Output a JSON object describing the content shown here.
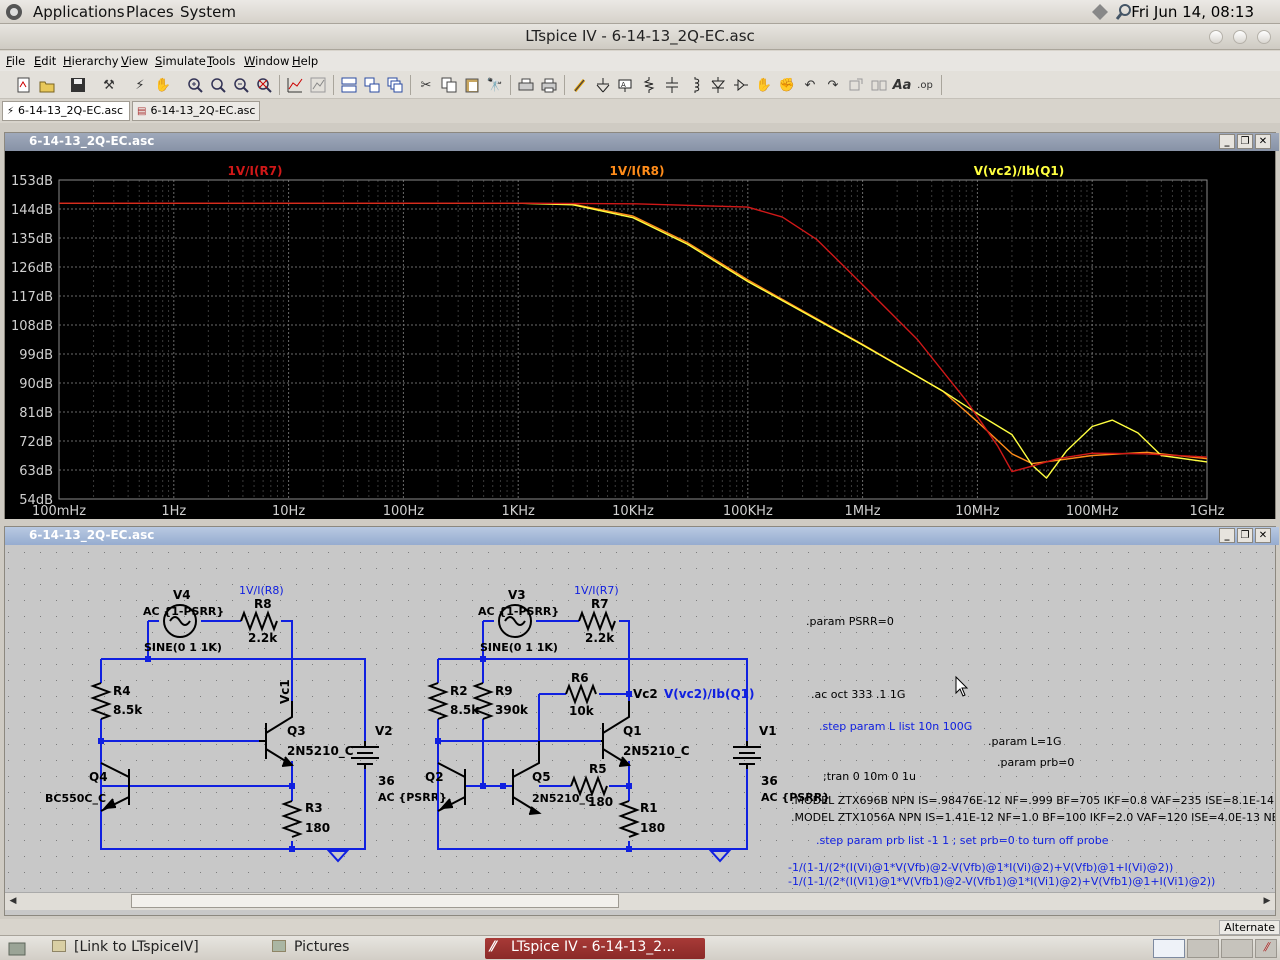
{
  "top_panel": {
    "menus": [
      "Applications",
      "Places",
      "System"
    ],
    "clock": "Fri Jun 14, 08:13"
  },
  "window": {
    "title": "LTspice IV - 6-14-13_2Q-EC.asc"
  },
  "menubar": [
    "File",
    "Edit",
    "Hierarchy",
    "View",
    "Simulate",
    "Tools",
    "Window",
    "Help"
  ],
  "toolbar_icons": [
    "new-schematic-icon",
    "open-icon",
    "save-icon",
    "control-panel-icon",
    "run-icon",
    "halt-icon",
    "zoom-in-icon",
    "zoom-out-icon",
    "zoom-fit-icon",
    "zoom-cancel-icon",
    "autorange-icon",
    "pick-trace-icon",
    "tile-horizontal-icon",
    "tile-vertical-icon",
    "cascade-icon",
    "cut-icon",
    "copy-icon",
    "paste-icon",
    "find-icon",
    "print-setup-icon",
    "print-icon",
    "draw-wire-icon",
    "ground-icon",
    "label-net-icon",
    "resistor-icon",
    "capacitor-icon",
    "inductor-icon",
    "diode-icon",
    "component-icon",
    "move-icon",
    "drag-icon",
    "undo-icon",
    "redo-icon",
    "rotate-icon",
    "mirror-icon",
    "text-icon",
    "spice-directive-icon"
  ],
  "doc_tabs": [
    {
      "label": "6-14-13_2Q-EC.asc",
      "icon": "schematic-tab-icon"
    },
    {
      "label": "6-14-13_2Q-EC.asc",
      "icon": "waveform-tab-icon"
    }
  ],
  "plot_window": {
    "title": "6-14-13_2Q-EC.asc"
  },
  "chart_data": {
    "type": "line",
    "x_scale": "log",
    "xlim": [
      0.1,
      1000000000
    ],
    "ylim": [
      54,
      153
    ],
    "grid": true,
    "x_tick_labels": [
      "100mHz",
      "1Hz",
      "10Hz",
      "100Hz",
      "1KHz",
      "10KHz",
      "100KHz",
      "1MHz",
      "10MHz",
      "100MHz",
      "1GHz"
    ],
    "y_tick_labels": [
      "153dB",
      "144dB",
      "135dB",
      "126dB",
      "117dB",
      "108dB",
      "99dB",
      "90dB",
      "81dB",
      "72dB",
      "63dB",
      "54dB"
    ],
    "y_ticks": [
      153,
      144,
      135,
      126,
      117,
      108,
      99,
      90,
      81,
      72,
      63,
      54
    ],
    "series": [
      {
        "name": "1V/I(R7)",
        "color": "#d01818",
        "x": [
          0.1,
          1000,
          10000,
          100000,
          200000,
          400000,
          1000000,
          3000000,
          8000000,
          15000000,
          20000000,
          30000000,
          50000000,
          100000000,
          300000000,
          1000000000
        ],
        "y": [
          145.8,
          145.8,
          145.6,
          144.6,
          141.5,
          134.5,
          120.5,
          103.5,
          84.5,
          70.5,
          62.5,
          64.2,
          66.5,
          68.2,
          68.0,
          67.0
        ]
      },
      {
        "name": "1V/I(R8)",
        "color": "#ff8c1a",
        "x": [
          0.1,
          1000,
          3000,
          10000,
          30000,
          100000,
          1000000,
          5000000,
          10000000,
          20000000,
          30000000,
          50000000,
          100000000,
          300000000,
          1000000000
        ],
        "y": [
          145.8,
          145.8,
          145.5,
          141.8,
          133.5,
          122.0,
          102.0,
          87.5,
          78.0,
          68.0,
          65.0,
          66.0,
          67.5,
          68.5,
          66.5
        ]
      },
      {
        "name": "V(vc2)/Ib(Q1)",
        "color": "#ffff40",
        "x": [
          0.1,
          1000,
          3000,
          10000,
          30000,
          100000,
          1000000,
          5000000,
          10000000,
          20000000,
          30000000,
          40000000,
          60000000,
          100000000,
          150000000,
          250000000,
          400000000,
          1000000000
        ],
        "y": [
          145.8,
          145.8,
          145.3,
          141.3,
          133.0,
          121.5,
          101.8,
          87.5,
          80.5,
          74.0,
          64.5,
          60.5,
          69.0,
          76.5,
          78.5,
          74.5,
          67.5,
          65.5
        ]
      }
    ]
  },
  "schematic_window": {
    "title": "6-14-13_2Q-EC.asc"
  },
  "schematic": {
    "left_circuit": {
      "probe": "1V/I(R8)",
      "source_name": "V4",
      "source_ac": "AC {1-PSRR}",
      "source_sine": "SINE(0 1 1K)",
      "r8": {
        "name": "R8",
        "value": "2.2k"
      },
      "r4": {
        "name": "R4",
        "value": "8.5k"
      },
      "r3": {
        "name": "R3",
        "value": "180"
      },
      "q3": {
        "name": "Q3",
        "model": "2N5210_C"
      },
      "q4": {
        "name": "Q4",
        "model": "BC550C_C"
      },
      "v2": {
        "name": "V2",
        "value": "36"
      },
      "net": "Vc1",
      "overlap_text": "AC {PSRR}"
    },
    "right_circuit": {
      "probe": "1V/I(R7)",
      "source_name": "V3",
      "source_ac": "AC {1-PSRR}",
      "source_sine": "SINE(0 1 1K)",
      "r7": {
        "name": "R7",
        "value": "2.2k"
      },
      "r2": {
        "name": "R2",
        "value": "8.5k"
      },
      "r9": {
        "name": "R9",
        "value": "390k"
      },
      "r6": {
        "name": "R6",
        "value": "10k"
      },
      "r5": {
        "name": "R5",
        "value": "180"
      },
      "r1": {
        "name": "R1",
        "value": "180"
      },
      "q1": {
        "name": "Q1",
        "model": "2N5210_C"
      },
      "q2": {
        "name": "Q2"
      },
      "q5": {
        "name": "Q5",
        "model": "2N5210_C"
      },
      "v1": {
        "name": "V1",
        "value": "36",
        "ac": "AC {PSRR}"
      },
      "net": "Vc2",
      "probe2": "V(vc2)/Ib(Q1)"
    },
    "directives": {
      "param_psrr": ".param PSRR=0",
      "ac": ".ac oct 333 .1 1G",
      "step_l": ".step param L list 10n 100G",
      "param_l": ".param L=1G",
      "param_prb": ".param prb=0",
      "tran": ";tran 0 10m 0 1u",
      "model1": ".MODEL ZTX696B NPN IS=.98476E-12 NF=.999 BF=705 IKF=0.8 VAF=235 ISE=8.1E-14 NE=",
      "model2": ".MODEL ZTX1056A NPN IS=1.41E-12 NF=1.0 BF=100 IKF=2.0 VAF=120 ISE=4.0E-13 NE=",
      "step_prb": ".step param prb list -1 1 ; set prb=0 to turn off probe",
      "expr1": "-1/(1-1/(2*(I(Vi)@1*V(Vfb)@2-V(Vfb)@1*I(Vi)@2)+V(Vfb)@1+I(Vi)@2))",
      "expr2": "-1/(1-1/(2*(I(Vi1)@1*V(Vfb1)@2-V(Vfb1)@1*I(Vi1)@2)+V(Vfb1)@1+I(Vi1)@2))"
    }
  },
  "status": {
    "mode": "Alternate"
  },
  "taskbar": {
    "items": [
      "[Link to LTspiceIV]",
      "Pictures",
      "LTspice IV - 6-14-13_2..."
    ]
  }
}
